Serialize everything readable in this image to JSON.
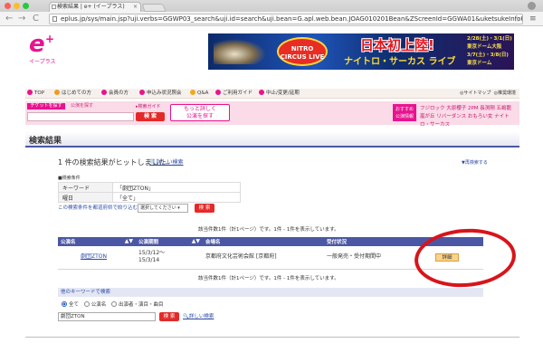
{
  "browser": {
    "tab_title": "検索結果 | e+ (イープラス)",
    "tab_close": "×",
    "url": "eplus.jp/sys/main.jsp?uji.verbs=GGWP03_search&uji.id=search&uji.bean=G.apl.web.bean.JOAG010201Bean&ZScreenId=GGWA01&uketsukeInfoKubu...",
    "back": "←",
    "forward": "→",
    "reload": "C",
    "star": "☆",
    "menu": "≡"
  },
  "site": {
    "logo_mark": "e",
    "logo_plus": "+",
    "logo_name": "イープラス"
  },
  "banner": {
    "circus": "NITRO CIRCUS LIVE",
    "headline": "日本初上陸!",
    "subhead": "ナイトロ・サーカス ライブ",
    "date1": "2/28(土)・3/1(日)",
    "venue1": "東京ドーム大阪",
    "date2": "3/7(土)・3/8(日)",
    "venue2": "東京ドーム"
  },
  "nav": {
    "items": [
      "TOP",
      "はじめての方",
      "会員の方",
      "申込み状況照会",
      "Q&A",
      "ご利用ガイド",
      "中止/変更/延期"
    ],
    "colors": [
      "#e8138f",
      "#f29a1f",
      "#e8138f",
      "#e8138f",
      "#f2a81f",
      "#e8138f",
      "#e8138f"
    ],
    "sitemap": "◎サイトマップ",
    "help": "◎推奨環境"
  },
  "searchbar": {
    "ticket_label": "チケットを探す",
    "kw_label": "公演を探す",
    "guide_label": "▸検索ガイド",
    "search_button": "検 索",
    "more_button_line1": "もっと詳しく",
    "more_button_line2": "公演を探す",
    "recommend_label_1": "おすすめ",
    "recommend_label_2": "公演情報",
    "recommend_words": "フジロック 大原櫻子 2PM 長渕剛 五嶋龍 嵐が丘 リバーダンス おもろい女 ナイトロ・サーカス"
  },
  "main": {
    "section_title": "検索結果",
    "hit_message": "1 件の検索結果がヒットしました。",
    "detail_search": "詳しい検索",
    "research_link": "▼再検索する",
    "conditions_label": "■検索条件",
    "conditions": [
      {
        "label": "キーワード",
        "value": "「劇団ZTON」"
      },
      {
        "label": "曜日",
        "value": "「全て」"
      }
    ],
    "narrow_label": "この検索条件を都道府県で絞り込む",
    "narrow_select": "選択してください",
    "narrow_button": "検 索",
    "page_note_top": "該当件数1件（計1ページ）です。1件 - 1件を表示しています。",
    "page_note_bottom": "該当件数1件（計1ページ）です。1件 - 1件を表示しています。"
  },
  "results": {
    "headers": [
      "公演名",
      "公演期間",
      "会場名",
      "受付状況",
      ""
    ],
    "sort_glyph": "▲▼",
    "rows": [
      {
        "name": "劇団ZTON",
        "period_1": "15/3/12～",
        "period_2": "15/3/14",
        "venue": "京都府文化芸術会館 [京都府]",
        "status": "一般発売・受付期間中",
        "detail": "詳細"
      }
    ]
  },
  "other_search": {
    "header": "他のキーワードで検索",
    "radio_options": [
      "全て",
      "公演名",
      "出演者・演目・曲目"
    ],
    "selected": "全て",
    "input_value": "劇団ZTON",
    "button": "検 索",
    "detail_link": "詳しい検索"
  },
  "colors": {
    "brand_pink": "#e8138f",
    "nav_blue": "#4b57a4",
    "red_button": "#e42a28",
    "annotation_red": "#d8141b"
  }
}
